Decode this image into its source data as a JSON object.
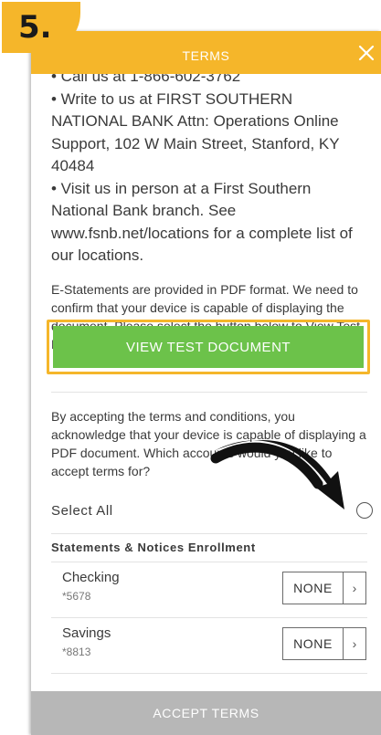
{
  "step": {
    "label": "5."
  },
  "header": {
    "title": "TERMS",
    "close_icon": "close-icon"
  },
  "contact": {
    "call_line": "• Call us at 1-866-602-3762",
    "write_line": "• Write to us at FIRST SOUTHERN NATIONAL BANK Attn: Operations Online Support, 102 W Main Street, Stanford, KY 40484",
    "visit_line": "• Visit us in person at a First Southern National Bank branch. See www.fsnb.net/locations for a complete list of our locations."
  },
  "estatement_info": "E-Statements are provided in PDF format. We need to confirm that your device is capable of displaying the document. Please select the button below to View Test Document.",
  "view_button_label": "VIEW TEST DOCUMENT",
  "accept_info": "By accepting the terms and conditions, you acknowledge that your device is capable of displaying a PDF document. Which accounts would you like to accept terms for?",
  "select_all_label": "Select All",
  "section_label": "Statements & Notices Enrollment",
  "accounts": [
    {
      "name": "Checking",
      "number": "*5678",
      "selection": "NONE"
    },
    {
      "name": "Savings",
      "number": "*8813",
      "selection": "NONE"
    }
  ],
  "footer_button_label": "ACCEPT TERMS",
  "colors": {
    "accent": "#f5b62a",
    "button_green": "#6cc24a",
    "footer_gray": "#b7b7b7"
  }
}
